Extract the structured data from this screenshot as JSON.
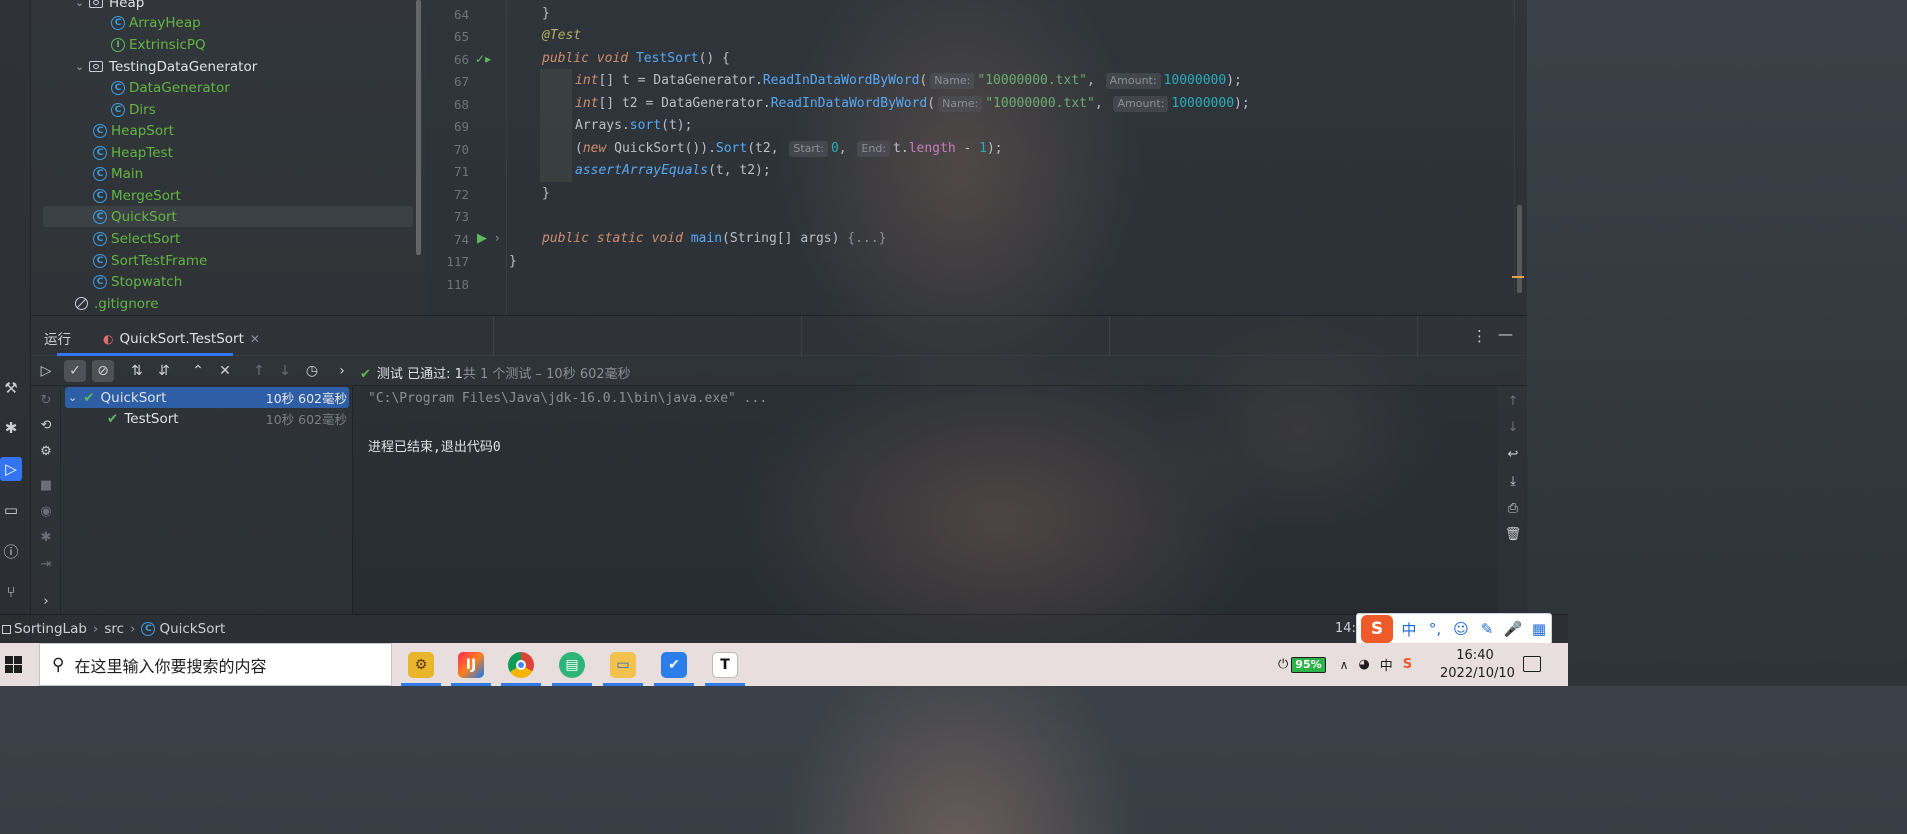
{
  "project_tree": {
    "items": [
      {
        "label": "Heap",
        "kind": "package",
        "expanded": true
      },
      {
        "label": "ArrayHeap",
        "kind": "class"
      },
      {
        "label": "ExtrinsicPQ",
        "kind": "interface"
      },
      {
        "label": "TestingDataGenerator",
        "kind": "package",
        "expanded": true
      },
      {
        "label": "DataGenerator",
        "kind": "class"
      },
      {
        "label": "Dirs",
        "kind": "class"
      },
      {
        "label": "HeapSort",
        "kind": "class"
      },
      {
        "label": "HeapTest",
        "kind": "class"
      },
      {
        "label": "Main",
        "kind": "class"
      },
      {
        "label": "MergeSort",
        "kind": "class"
      },
      {
        "label": "QuickSort",
        "kind": "class",
        "selected": true
      },
      {
        "label": "SelectSort",
        "kind": "class"
      },
      {
        "label": "SortTestFrame",
        "kind": "class"
      },
      {
        "label": "Stopwatch",
        "kind": "class"
      },
      {
        "label": ".gitignore",
        "kind": "ignore"
      }
    ]
  },
  "editor": {
    "line_numbers": [
      "64",
      "65",
      "66",
      "67",
      "68",
      "69",
      "70",
      "71",
      "72",
      "73",
      "74",
      "117",
      "118"
    ],
    "hints": {
      "name": "Name:",
      "amount": "Amount:",
      "start": "Start:",
      "end": "End:"
    },
    "tokens": {
      "close_brace": "}",
      "annotation": "@Test",
      "public": "public",
      "void": "void",
      "static": "static",
      "int_arr": "int",
      "new": "new",
      "test_method": "TestSort",
      "main_method": "main",
      "var_t": "t",
      "var_t2": "t2",
      "data_gen": "DataGenerator",
      "read_fn": "ReadInDataWordByWord",
      "file_str": "\"10000000.txt\"",
      "amount_num": "10000000",
      "arrays": "Arrays",
      "sort_fn": "sort",
      "quicksort_cls": "QuickSort",
      "sort_method": "Sort",
      "zero": "0",
      "length": "length",
      "one": "1",
      "assert_fn": "assertArrayEquals",
      "main_params": "(String[] args)",
      "folded": "{...}"
    }
  },
  "run_panel": {
    "label": "运行",
    "tab_title": "QuickSort.TestSort",
    "status_prefix": "测试",
    "status_passed": "已通过: 1",
    "status_rest": "共 1 个测试 – 10秒 602毫秒",
    "tests": [
      {
        "name": "QuickSort",
        "time": "10秒 602毫秒",
        "selected": true
      },
      {
        "name": "TestSort",
        "time": "10秒 602毫秒",
        "selected": false
      }
    ],
    "console": {
      "command": "\"C:\\Program Files\\Java\\jdk-16.0.1\\bin\\java.exe\" ...",
      "exit_message": "进程已结束,退出代码0"
    }
  },
  "statusbar": {
    "breadcrumbs": [
      "SortingLab",
      "src",
      "QuickSort"
    ],
    "caret": "14:1"
  },
  "ime": {
    "logo": "S",
    "items": [
      "中",
      "°,",
      "☺",
      "✎",
      "🎤",
      "▦"
    ]
  },
  "taskbar": {
    "search_placeholder": "在这里输入你要搜索的内容",
    "battery": "95%",
    "time": "16:40",
    "date": "2022/10/10",
    "tray_lang": "中"
  },
  "colors": {
    "accent": "#3574f0",
    "test_pass": "#5fb85f",
    "keyword": "#cf8e6d",
    "function": "#56a8f5",
    "string": "#6aab73",
    "number": "#2aacb8"
  }
}
